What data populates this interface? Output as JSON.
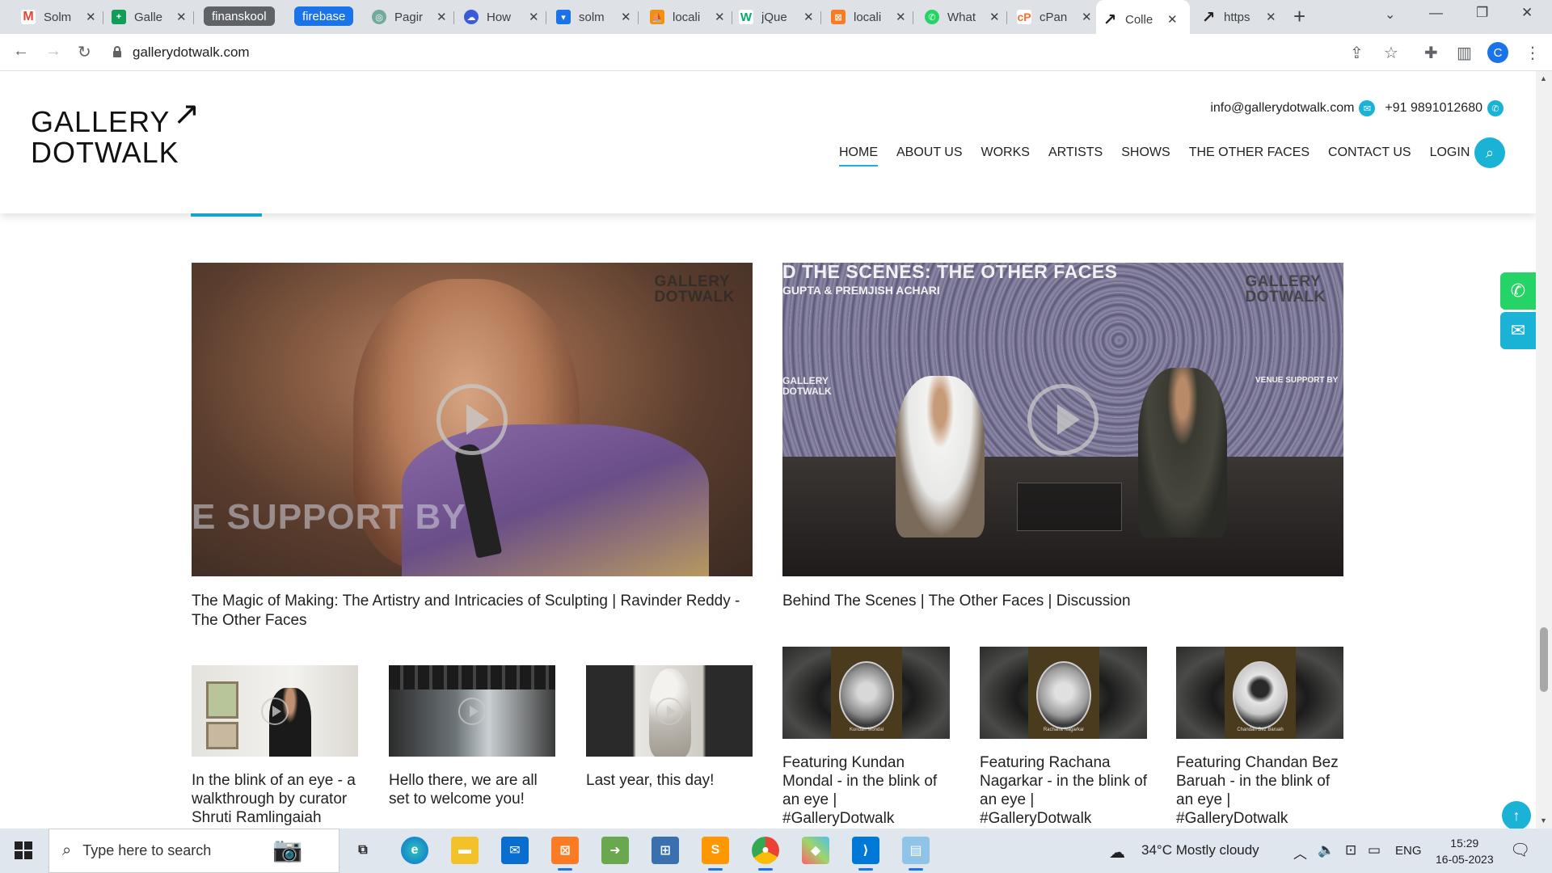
{
  "browser": {
    "tabs": [
      {
        "title": "Solm",
        "favicon": "gmail-icon",
        "color": "#ea4335"
      },
      {
        "title": "Galle",
        "favicon": "sheets-icon",
        "color": "#0f9d58"
      },
      {
        "title": "finanskool",
        "pill": true,
        "color": "#5f6368"
      },
      {
        "title": "firebase",
        "pill": true,
        "color": "#1a73e8"
      },
      {
        "title": "Pagir",
        "favicon": "chatgpt-icon",
        "color": "#74aa9c"
      },
      {
        "title": "How",
        "favicon": "cloud-icon",
        "color": "#3a5bd9"
      },
      {
        "title": "solm",
        "favicon": "shield-icon",
        "color": "#1a73e8"
      },
      {
        "title": "locali",
        "favicon": "phpmyadmin-icon",
        "color": "#f29111"
      },
      {
        "title": "jQue",
        "favicon": "w3schools-icon",
        "color": "#04aa6d"
      },
      {
        "title": "locali",
        "favicon": "xampp-icon",
        "color": "#fb7a24"
      },
      {
        "title": "What",
        "favicon": "whatsapp-icon",
        "color": "#25d366"
      },
      {
        "title": "cPan",
        "favicon": "cpanel-icon",
        "color": "#ff6c2c"
      },
      {
        "title": "Colle",
        "favicon": "arrow-icon",
        "color": "#222222",
        "active": true
      },
      {
        "title": "https",
        "favicon": "arrow-icon",
        "color": "#222222"
      }
    ],
    "url": "gallerydotwalk.com",
    "profile_initial": "C"
  },
  "site": {
    "logo_line1": "GALLERY",
    "logo_line2": "DOTWALK",
    "logo_arrow": "↗",
    "email": "info@gallerydotwalk.com",
    "phone": "+91 9891012680",
    "nav": [
      "HOME",
      "ABOUT US",
      "WORKS",
      "ARTISTS",
      "SHOWS",
      "THE OTHER FACES",
      "CONTACT US",
      "LOGIN"
    ],
    "accent_color": "#1ab3d6"
  },
  "videos": {
    "v1": {
      "caption": "The Magic of Making: The Artistry and Intricacies of Sculpting | Ravinder Reddy - The Other Faces",
      "overlay": "E SUPPORT BY",
      "watermark1": "GALLERY",
      "watermark2": "DOTWALK"
    },
    "v2": {
      "caption": "Behind The Scenes | The Other Faces | Discussion",
      "banner1": "D THE SCENES: THE OTHER FACES",
      "banner2": "GUPTA & PREMJISH ACHARI",
      "venue": "VENUE SUPPORT BY",
      "logo_left": "GALLERY DOTWALK",
      "watermark1": "GALLERY",
      "watermark2": "DOTWALK"
    },
    "s1": {
      "caption": "In the blink of an eye - a walkthrough by curator Shruti Ramlingaiah"
    },
    "s2": {
      "caption": "Hello there, we are all set to welcome you!"
    },
    "s3": {
      "caption": "Last year, this day!"
    },
    "s4": {
      "caption": "Featuring Kundan Mondal - in the blink of an eye | #GalleryDotwalk",
      "name_tag": "Kundan Mondal"
    },
    "s5": {
      "caption": "Featuring Rachana Nagarkar - in the blink of an eye | #GalleryDotwalk",
      "name_tag": "Rachana Nagarkar"
    },
    "s6": {
      "caption": "Featuring Chandan Bez Baruah - in the blink of an eye | #GalleryDotwalk",
      "name_tag": "Chandan Bez Baruah"
    }
  },
  "taskbar": {
    "search_placeholder": "Type here to search",
    "weather": "34°C  Mostly cloudy",
    "lang": "ENG",
    "time": "15:29",
    "date": "16-05-2023"
  }
}
